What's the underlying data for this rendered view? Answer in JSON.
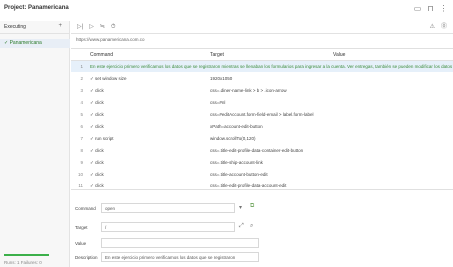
{
  "header": {
    "title": "Project: Panamericana",
    "icons": [
      "folder-icon",
      "save-icon",
      "kebab-icon"
    ]
  },
  "sidebar": {
    "exec_label": "Executing",
    "exec_plus": "+",
    "suite": "✓ Panamericana",
    "runs": "Runs: 1   Failures: 0"
  },
  "toolbar": {
    "left_icons": [
      "▷|",
      "▷",
      "≒",
      "⏱"
    ],
    "right_icons": [
      "⚠",
      "⓪"
    ]
  },
  "url": "https://www.panamericana.com.co",
  "table": {
    "headers": {
      "num": "",
      "command": "Command",
      "target": "Target",
      "value": "Value"
    },
    "comment_row": {
      "num": "1",
      "text": "En este ejercicio primero verificamos los datos que se registraron mientras se llenaban los formularios para ingresar a la cuenta. Ver entregas, también se pueden modificar los datos de entrega y al nombre del destinatario."
    },
    "rows": [
      {
        "num": "2",
        "command": "✓ set window size",
        "target": "1920x1050"
      },
      {
        "num": "3",
        "command": "✓ click",
        "target": "css=.diner-name-link > b > .icon-arrow"
      },
      {
        "num": "4",
        "command": "✓ click",
        "target": "css=#nl"
      },
      {
        "num": "5",
        "command": "✓ click",
        "target": "css=#editAccount.form-field-email > label.form-label"
      },
      {
        "num": "6",
        "command": "✓ click",
        "target": "xPath=account-edit-button"
      },
      {
        "num": "7",
        "command": "✓ run script",
        "target": "window.scrollTo(0,120)"
      },
      {
        "num": "8",
        "command": "✓ click",
        "target": "css=.title-edit-profile-data-container-edit-button"
      },
      {
        "num": "9",
        "command": "✓ click",
        "target": "css=.title-ship-account-link"
      },
      {
        "num": "10",
        "command": "✓ click",
        "target": "css=.title-account-button-edit"
      },
      {
        "num": "11",
        "command": "✓ click",
        "target": "css=.title-edit-profile-data-account-edit"
      }
    ]
  },
  "editor": {
    "command_label": "Command",
    "command_value": "open",
    "target_label": "Target",
    "target_value": "/",
    "value_label": "Value",
    "value_value": "",
    "description_label": "Description",
    "description_value": "En este ejercicio primero verificamos los datos que se registraron"
  }
}
